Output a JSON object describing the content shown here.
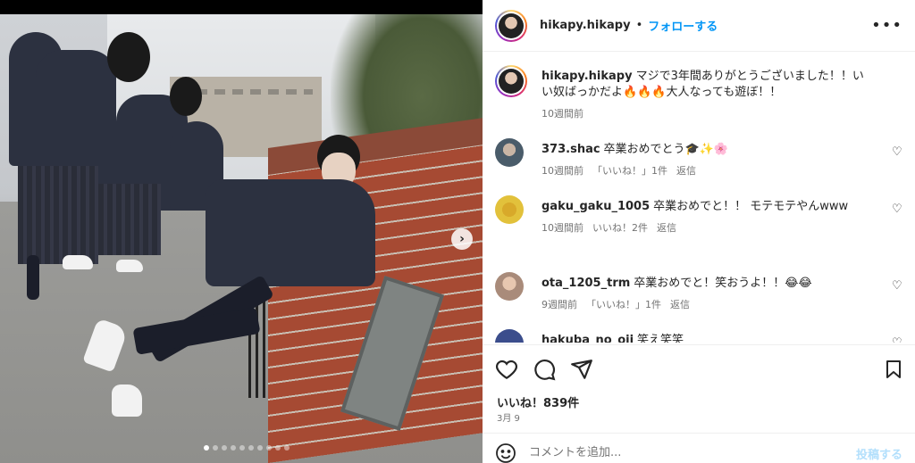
{
  "header": {
    "username": "hikapy.hikapy",
    "separator": "•",
    "follow_label": "フォローする",
    "more_label": "•••"
  },
  "caption": {
    "username": "hikapy.hikapy",
    "text": "マジで3年間ありがとうございました！！いい奴ばっかだよ🔥🔥🔥大人なっても遊ぼ！！",
    "time": "10週間前"
  },
  "comments": [
    {
      "username": "373.shac",
      "text": "卒業おめでとう🎓✨🌸",
      "time": "10週間前",
      "likes": "「いいね！」1件",
      "reply": "返信",
      "avatar_color": "#4a5c6a"
    },
    {
      "username": "gaku_gaku_1005",
      "text": "卒業おめでと！！ モテモテやんwww",
      "time": "10週間前",
      "likes": "いいね！2件",
      "reply": "返信",
      "avatar_color": "#e2c13b"
    },
    {
      "username": "ota_1205_trm",
      "text": "卒業おめでと！笑おうよ！！😂😂",
      "time": "9週間前",
      "likes": "「いいね！」1件",
      "reply": "返信",
      "avatar_color": "#a98b7a"
    },
    {
      "username": "hakuba_no_oji",
      "text": "笑え笑笑",
      "time": "",
      "likes": "",
      "reply": "",
      "avatar_color": "#3b4d8c"
    }
  ],
  "actions": {
    "likes": "いいね！839件",
    "date": "3月 9"
  },
  "add_comment": {
    "placeholder": "コメントを追加...",
    "post_label": "投稿する"
  },
  "carousel": {
    "next_label": "›",
    "slide_count": 10,
    "active_index": 0
  }
}
